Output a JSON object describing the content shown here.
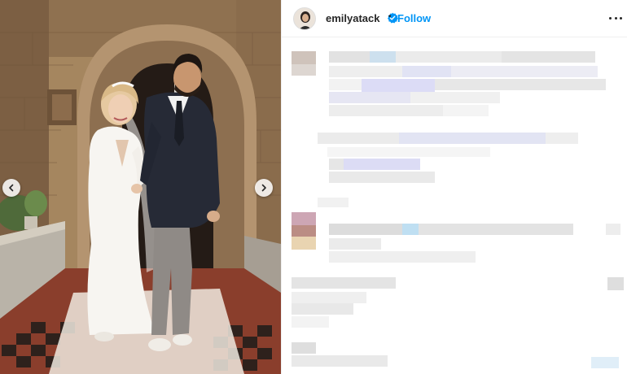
{
  "post": {
    "author": {
      "username": "emilyatack",
      "verified": true
    },
    "separator": "•",
    "follow_label": "Follow",
    "media": {
      "carousel": true
    }
  },
  "colors": {
    "follow_blue": "#0095f6",
    "verified_blue": "#0095f6",
    "text": "#262626",
    "divider": "#efefef"
  },
  "icons": {
    "prev": "chevron-left-icon",
    "next": "chevron-right-icon",
    "verified": "verified-badge-icon",
    "more": "more-options-icon"
  }
}
